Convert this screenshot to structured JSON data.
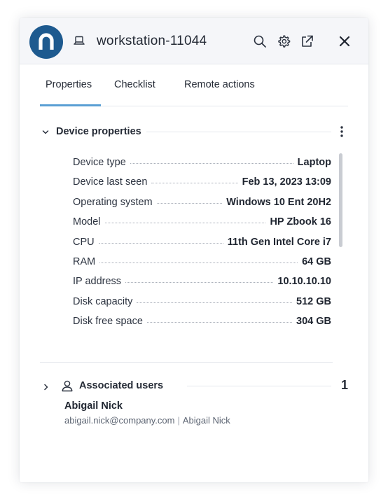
{
  "header": {
    "title": "workstation-11044",
    "logo_icon": "n-brand-logo",
    "device_icon": "laptop-icon",
    "colors": {
      "logo_bg": "#1e5a8f",
      "header_bg": "#f5f6f9",
      "tab_accent": "#5a9fd4"
    }
  },
  "tabs": [
    {
      "label": "Properties",
      "active": true
    },
    {
      "label": "Checklist",
      "active": false
    },
    {
      "label": "Remote actions",
      "active": false
    }
  ],
  "device_properties": {
    "title": "Device properties",
    "expanded": true,
    "rows": [
      {
        "label": "Device type",
        "value": "Laptop"
      },
      {
        "label": "Device last seen",
        "value": "Feb 13, 2023 13:09"
      },
      {
        "label": "Operating system",
        "value": "Windows 10 Ent 20H2"
      },
      {
        "label": "Model",
        "value": "HP Zbook 16"
      },
      {
        "label": "CPU",
        "value": "11th Gen Intel Core i7"
      },
      {
        "label": "RAM",
        "value": "64 GB"
      },
      {
        "label": "IP address",
        "value": "10.10.10.10"
      },
      {
        "label": "Disk capacity",
        "value": "512 GB"
      },
      {
        "label": "Disk free space",
        "value": "304 GB"
      }
    ]
  },
  "associated_users": {
    "title": "Associated users",
    "count": "1",
    "expanded": false,
    "user": {
      "name": "Abigail Nick",
      "email": "abigail.nick@company.com",
      "separator": "|",
      "display_name": "Abigail Nick"
    }
  }
}
